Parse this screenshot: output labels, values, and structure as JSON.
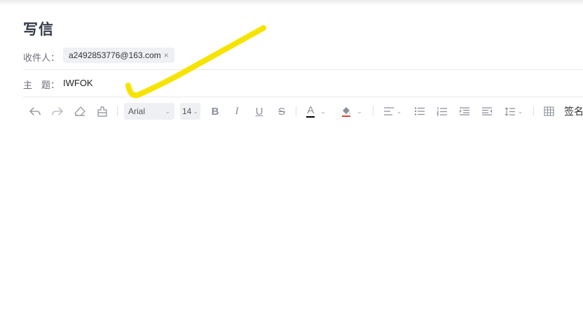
{
  "compose": {
    "title": "写信",
    "recipient_label": "收件人：",
    "recipients": [
      {
        "address": "a2492853776@163.com",
        "remove_glyph": "×"
      }
    ],
    "subject_label": "主　题：",
    "subject_value": "IWFOK"
  },
  "toolbar": {
    "font_family": "Arial",
    "font_size": "14",
    "bold": "B",
    "italic": "I",
    "underline": "U",
    "strikethrough": "S",
    "font_color_letter": "A",
    "font_color_hex": "#000000",
    "highlight_color_hex": "#e8403a",
    "signature_label": "签名"
  },
  "overlay": {
    "checkmark_color": "#f7e300"
  }
}
